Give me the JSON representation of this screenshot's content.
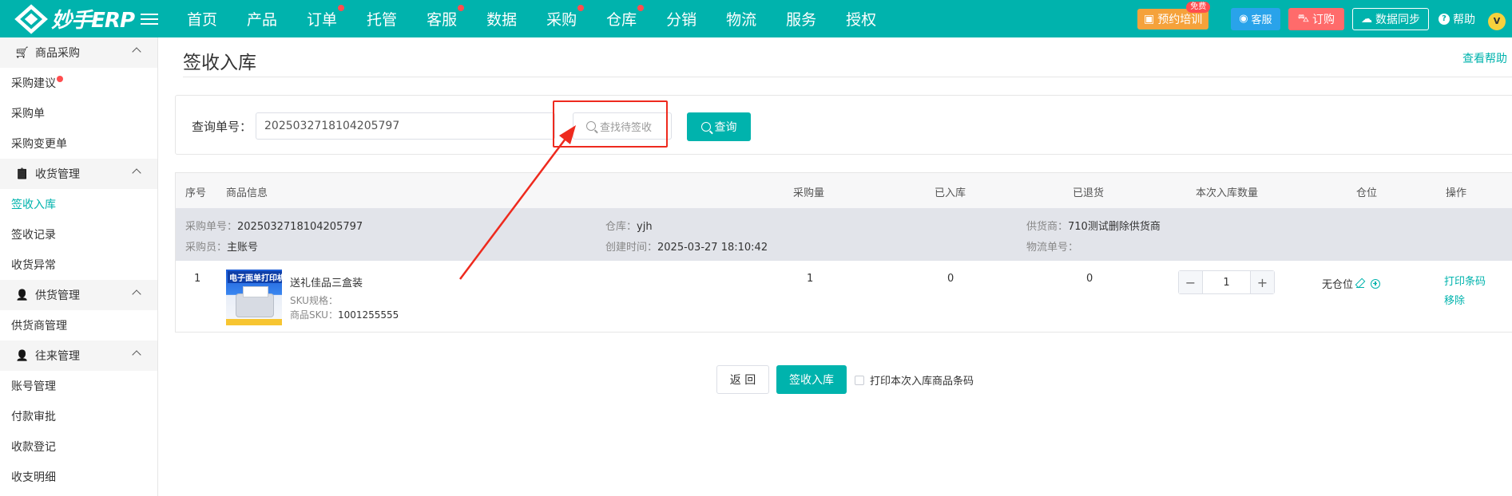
{
  "app": {
    "logo_text": "妙手ERP"
  },
  "nav": [
    {
      "label": "首页",
      "dot": false
    },
    {
      "label": "产品",
      "dot": false
    },
    {
      "label": "订单",
      "dot": true
    },
    {
      "label": "托管",
      "dot": false
    },
    {
      "label": "客服",
      "dot": true
    },
    {
      "label": "数据",
      "dot": false
    },
    {
      "label": "采购",
      "dot": true
    },
    {
      "label": "仓库",
      "dot": true
    },
    {
      "label": "分销",
      "dot": false
    },
    {
      "label": "物流",
      "dot": false
    },
    {
      "label": "服务",
      "dot": false
    },
    {
      "label": "授权",
      "dot": false
    }
  ],
  "tools": {
    "train_label": "预约培训",
    "free_badge": "免费",
    "service_label": "客服",
    "order_label": "订购",
    "sync_label": "数据同步",
    "help_label": "帮助",
    "avatar_letter": "V"
  },
  "sidebar": {
    "groups": [
      {
        "title": "商品采购",
        "icon": "cart-icon",
        "items": [
          {
            "label": "采购建议",
            "dot": true,
            "active": false
          },
          {
            "label": "采购单",
            "dot": false,
            "active": false
          },
          {
            "label": "采购变更单",
            "dot": false,
            "active": false
          }
        ]
      },
      {
        "title": "收货管理",
        "icon": "clipboard-check-icon",
        "items": [
          {
            "label": "签收入库",
            "dot": false,
            "active": true
          },
          {
            "label": "签收记录",
            "dot": false,
            "active": false
          },
          {
            "label": "收货异常",
            "dot": false,
            "active": false
          }
        ]
      },
      {
        "title": "供货管理",
        "icon": "user-gear-icon",
        "items": [
          {
            "label": "供货商管理",
            "dot": false,
            "active": false
          }
        ]
      },
      {
        "title": "往来管理",
        "icon": "user-icon",
        "items": [
          {
            "label": "账号管理",
            "dot": false,
            "active": false
          },
          {
            "label": "付款审批",
            "dot": false,
            "active": false
          },
          {
            "label": "收款登记",
            "dot": false,
            "active": false
          },
          {
            "label": "收支明细",
            "dot": false,
            "active": false
          }
        ]
      }
    ]
  },
  "page": {
    "title": "签收入库",
    "help_link": "查看帮助"
  },
  "search": {
    "label": "查询单号：",
    "value": "2025032718104205797",
    "pending_placeholder": "查找待签收",
    "query_button": "查询"
  },
  "table": {
    "headers": {
      "index": "序号",
      "product": "商品信息",
      "qty": "采购量",
      "stocked": "已入库",
      "returned": "已退货",
      "this_qty": "本次入库数量",
      "location": "仓位",
      "action": "操作"
    },
    "group": {
      "po_label": "采购单号：",
      "po_value": "2025032718104205797",
      "warehouse_label": "仓库：",
      "warehouse_value": "yjh",
      "supplier_label": "供货商：",
      "supplier_value": "710测试删除供货商",
      "buyer_label": "采购员：",
      "buyer_value": "主账号",
      "created_label": "创建时间：",
      "created_value": "2025-03-27 18:10:42",
      "logistics_label": "物流单号：",
      "logistics_value": ""
    },
    "rows": [
      {
        "index": "1",
        "thumb_text": "电子面单打印机",
        "name": "送礼佳品三盒装",
        "sku_spec_label": "SKU规格：",
        "sku_label": "商品SKU：",
        "sku_value": "1001255555",
        "qty": "1",
        "stocked": "0",
        "returned": "0",
        "this_qty": "1",
        "location": "无仓位",
        "action_print": "打印条码",
        "action_remove": "移除"
      }
    ]
  },
  "footer": {
    "back": "返 回",
    "confirm": "签收入库",
    "print_label": "打印本次入库商品条码"
  },
  "colors": {
    "brand": "#00b3ad",
    "highlight": "#ee2a1e"
  }
}
